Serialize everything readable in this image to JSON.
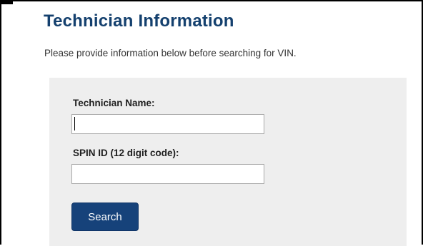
{
  "page": {
    "title": "Technician Information",
    "instructions": "Please provide information below before searching for VIN."
  },
  "form": {
    "technician_name": {
      "label": "Technician Name:",
      "value": ""
    },
    "spin_id": {
      "label": "SPIN ID (12 digit code):",
      "value": ""
    },
    "search_button_label": "Search"
  },
  "colors": {
    "title": "#14406e",
    "button": "#16427a",
    "panel": "#eeeeee"
  }
}
